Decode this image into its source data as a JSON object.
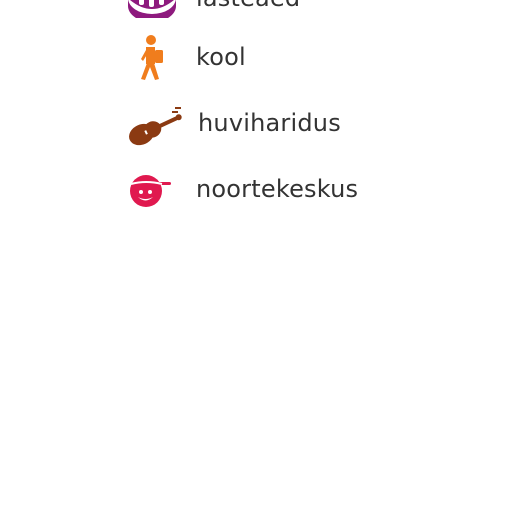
{
  "legend": {
    "items": [
      {
        "label": "lasteaed",
        "icon": "kindergarten-icon",
        "color": "#8e1a7e"
      },
      {
        "label": "kool",
        "icon": "school-pupil-icon",
        "color": "#f07d1d"
      },
      {
        "label": "huviharidus",
        "icon": "violin-icon",
        "color": "#8b3a12"
      },
      {
        "label": "noortekeskus",
        "icon": "smiley-cap-icon",
        "color": "#e0194f"
      }
    ]
  }
}
